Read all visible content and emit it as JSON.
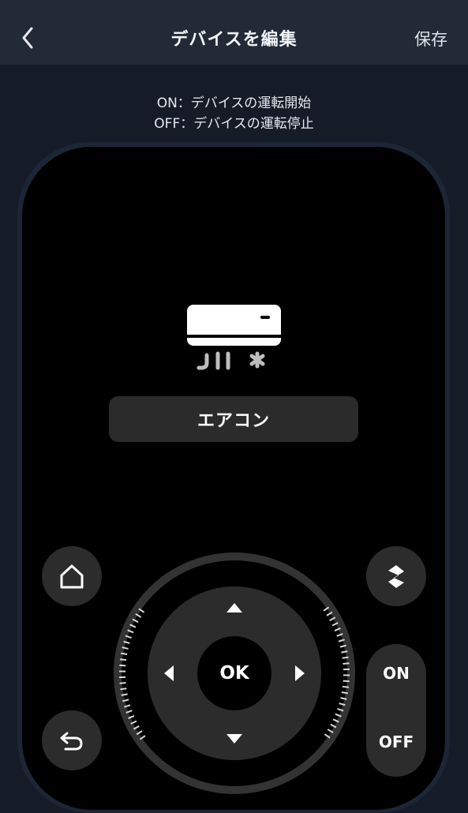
{
  "header": {
    "back_icon": "chevron-left-icon",
    "title": "デバイスを編集",
    "save_label": "保存"
  },
  "hints": {
    "on_line": "ON：デバイスの運転開始",
    "off_line": "OFF：デバイスの運転停止"
  },
  "device": {
    "icon": "air-conditioner-icon",
    "name": "エアコン"
  },
  "remote": {
    "home_icon": "home-icon",
    "back_icon": "return-arrow-icon",
    "mode_icon": "s-shape-icon",
    "ok_label": "OK",
    "on_label": "ON",
    "off_label": "OFF"
  }
}
